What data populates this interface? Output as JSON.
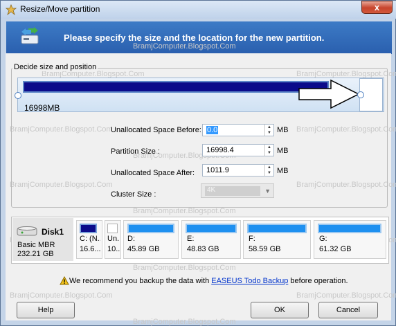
{
  "window": {
    "title": "Resize/Move partition",
    "close_glyph": "x"
  },
  "header": {
    "text": "Please specify the size and the location for the new partition."
  },
  "watermark": "BramjComputer.Blogspot.Com",
  "group": {
    "label": "Decide size and position",
    "size_label": "16998MB",
    "fields": {
      "before_label": "Unallocated Space Before:",
      "before_value": "0.0",
      "before_unit": "MB",
      "size_label": "Partition Size :",
      "size_value": "16998.4",
      "size_unit": "MB",
      "after_label": "Unallocated Space After:",
      "after_value": "1011.9",
      "after_unit": "MB",
      "cluster_label": "Cluster Size :",
      "cluster_value": "4K"
    }
  },
  "disk": {
    "name": "Disk1",
    "type": "Basic MBR",
    "size": "232.21 GB",
    "partitions": [
      {
        "label": "C: (N...",
        "size": "16.6...",
        "color": "#0b0b8a"
      },
      {
        "label": "Un...",
        "size": "10...",
        "color": "#ffffff"
      },
      {
        "label": "D:",
        "size": "45.89 GB",
        "color": "#1e90f0"
      },
      {
        "label": "E:",
        "size": "48.83 GB",
        "color": "#1e90f0"
      },
      {
        "label": "F:",
        "size": "58.59 GB",
        "color": "#1e90f0"
      },
      {
        "label": "G:",
        "size": "61.32 GB",
        "color": "#1e90f0"
      }
    ]
  },
  "warning": {
    "prefix": "We recommend you backup the data with ",
    "link": "EASEUS Todo Backup",
    "suffix": " before operation."
  },
  "buttons": {
    "help": "Help",
    "ok": "OK",
    "cancel": "Cancel"
  },
  "colors": {
    "partition_bar": "#0b0b8a",
    "header_bg": "#2f6ab8",
    "link": "#0033cc"
  }
}
